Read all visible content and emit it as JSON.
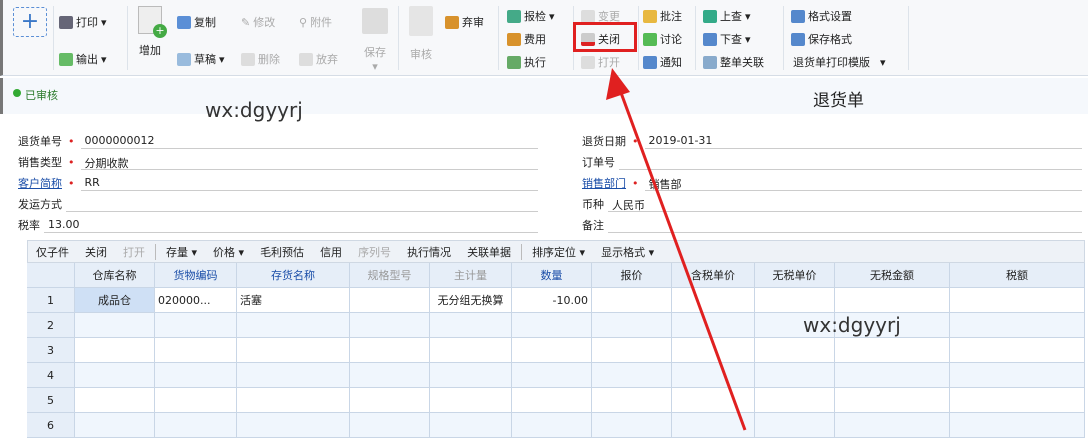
{
  "toolbar": {
    "add_icon": "plus-icon",
    "print": "打印",
    "export": "输出",
    "add": "增加",
    "copy": "复制",
    "draft": "草稿",
    "modify": "修改",
    "attachment": "附件",
    "delete": "删除",
    "discard": "放弃",
    "save": "保存",
    "audit": "审核",
    "abandon_audit": "弃审",
    "inspect": "报检",
    "expense": "费用",
    "execute": "执行",
    "change": "变更",
    "close": "关闭",
    "open": "打开",
    "annotate": "批注",
    "discuss": "讨论",
    "notify": "通知",
    "look_up": "上查",
    "look_down": "下查",
    "doc_link": "整单关联",
    "format_settings": "格式设置",
    "save_format": "保存格式",
    "print_template": "退货单打印模版"
  },
  "status": {
    "badge": "已审核",
    "title": "退货单"
  },
  "watermarks": [
    "wx:dgyyrj",
    "wx:dgyyrj"
  ],
  "form": {
    "left": [
      {
        "label": "退货单号",
        "required": true,
        "link": false,
        "value": "0000000012"
      },
      {
        "label": "销售类型",
        "required": true,
        "link": false,
        "value": "分期收款"
      },
      {
        "label": "客户简称",
        "required": true,
        "link": true,
        "value": "RR"
      },
      {
        "label": "发运方式",
        "required": false,
        "link": false,
        "value": ""
      },
      {
        "label": "税率",
        "required": false,
        "link": false,
        "value": "13.00"
      }
    ],
    "right": [
      {
        "label": "退货日期",
        "required": true,
        "link": false,
        "value": "2019-01-31"
      },
      {
        "label": "订单号",
        "required": false,
        "link": false,
        "value": ""
      },
      {
        "label": "销售部门",
        "required": true,
        "link": true,
        "value": "销售部"
      },
      {
        "label": "币种",
        "required": false,
        "link": false,
        "value": "人民币"
      },
      {
        "label": "备注",
        "required": false,
        "link": false,
        "value": ""
      }
    ]
  },
  "gridbar": [
    "仅子件",
    "关闭",
    "打开",
    "存量 ▾",
    "价格 ▾",
    "毛利预估",
    "信用",
    "序列号",
    "执行情况",
    "关联单据",
    "排序定位 ▾",
    "显示格式 ▾"
  ],
  "grid": {
    "columns": [
      "",
      "仓库名称",
      "货物编码",
      "存货名称",
      "规格型号",
      "主计量",
      "数量",
      "报价",
      "含税单价",
      "无税单价",
      "无税金额",
      "税额"
    ],
    "rows": [
      [
        "1",
        "成品仓",
        "020000...",
        "活塞",
        "",
        "无分组无换算",
        "-10.00",
        "",
        "",
        "",
        "",
        ""
      ],
      [
        "2",
        "",
        "",
        "",
        "",
        "",
        "",
        "",
        "",
        "",
        "",
        ""
      ],
      [
        "3",
        "",
        "",
        "",
        "",
        "",
        "",
        "",
        "",
        "",
        "",
        ""
      ],
      [
        "4",
        "",
        "",
        "",
        "",
        "",
        "",
        "",
        "",
        "",
        "",
        ""
      ],
      [
        "5",
        "",
        "",
        "",
        "",
        "",
        "",
        "",
        "",
        "",
        "",
        ""
      ],
      [
        "6",
        "",
        "",
        "",
        "",
        "",
        "",
        "",
        "",
        "",
        "",
        ""
      ]
    ]
  },
  "colors": {
    "highlight": "#e02020",
    "link": "#1b4ea8"
  }
}
